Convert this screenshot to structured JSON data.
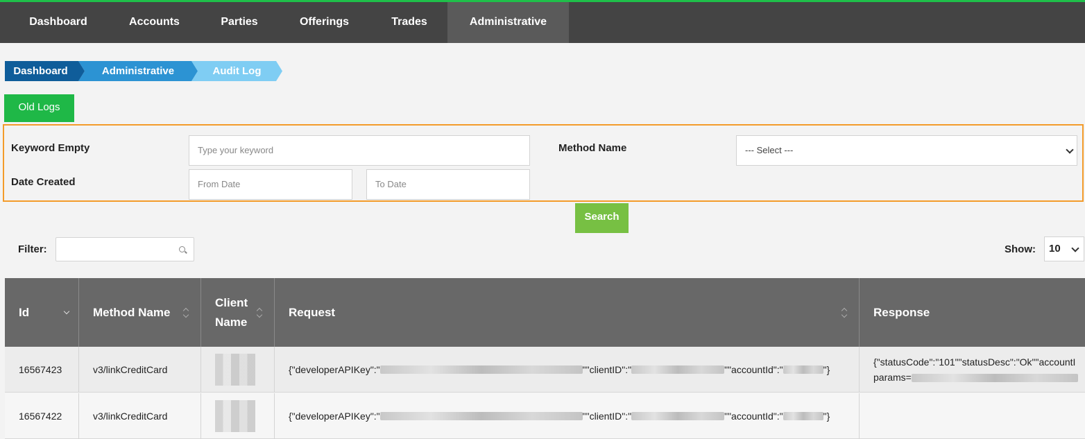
{
  "nav": {
    "items": [
      "Dashboard",
      "Accounts",
      "Parties",
      "Offerings",
      "Trades",
      "Administrative"
    ],
    "active": "Administrative",
    "accent_color": "#1fc04a"
  },
  "breadcrumb": [
    "Dashboard",
    "Administrative",
    "Audit Log"
  ],
  "buttons": {
    "old_logs": "Old Logs",
    "search": "Search"
  },
  "search_form": {
    "keyword_label": "Keyword Empty",
    "keyword_placeholder": "Type your keyword",
    "method_label": "Method Name",
    "method_selected": "--- Select ---",
    "date_label": "Date Created",
    "from_placeholder": "From Date",
    "to_placeholder": "To Date"
  },
  "table_controls": {
    "filter_label": "Filter:",
    "show_label": "Show:",
    "show_value": "10"
  },
  "table": {
    "columns": [
      "Id",
      "Method Name",
      "Client Name",
      "Request",
      "Response"
    ],
    "rows": [
      {
        "id": "16567423",
        "method": "v3/linkCreditCard",
        "request_prefix": "{\"developerAPIKey\":\"",
        "request_mid1": "\"\"clientID\":\"",
        "request_mid2": "\"\"accountId\":\"",
        "request_end": "\"}",
        "response_line1": "{\"statusCode\":\"101\"\"statusDesc\":\"Ok\"\"accountI",
        "response_line2": "params="
      },
      {
        "id": "16567422",
        "method": "v3/linkCreditCard",
        "request_prefix": "{\"developerAPIKey\":\"",
        "request_mid1": "\"\"clientID\":\"",
        "request_mid2": "\"\"accountId\":\"",
        "request_end": "\"}",
        "response_line1": "",
        "response_line2": ""
      }
    ]
  }
}
